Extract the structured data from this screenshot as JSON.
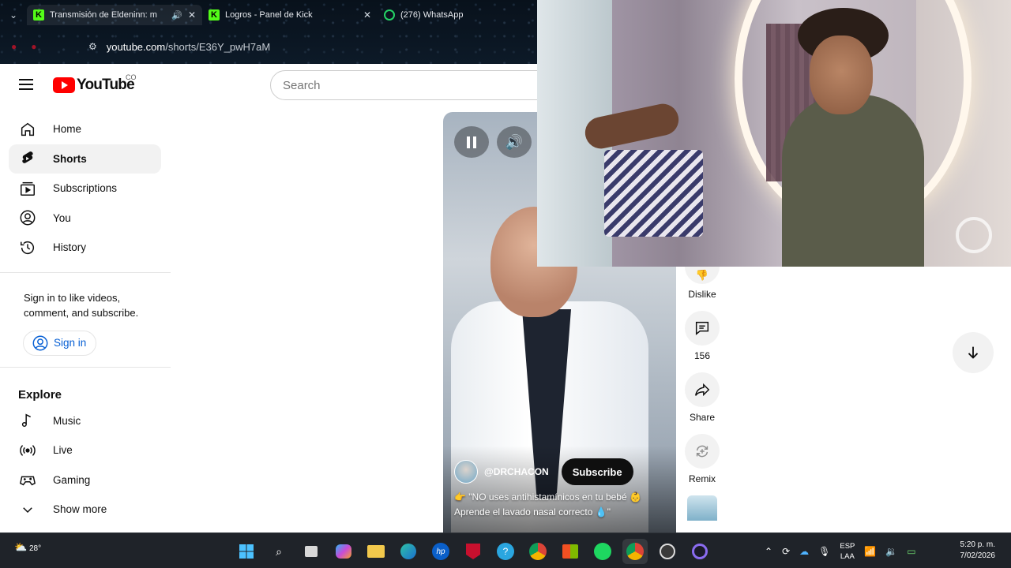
{
  "browser": {
    "tabs": [
      {
        "title": "Transmisión de Eldeninn: m",
        "icon": "kick-logo-icon"
      },
      {
        "title": "Logros - Panel de Kick",
        "icon": "kick-logo-icon"
      },
      {
        "title": "(276) WhatsApp",
        "icon": "whatsapp-icon"
      }
    ],
    "url_domain": "youtube.com",
    "url_path": "/shorts/E36Y_pwH7aM"
  },
  "youtube": {
    "logo_text": "YouTube",
    "country_code": "CO",
    "search_placeholder": "Search",
    "sidebar": {
      "main_items": [
        {
          "label": "Home",
          "icon": "home-icon"
        },
        {
          "label": "Shorts",
          "icon": "shorts-icon",
          "active": true
        },
        {
          "label": "Subscriptions",
          "icon": "subscriptions-icon"
        },
        {
          "label": "You",
          "icon": "account-icon"
        },
        {
          "label": "History",
          "icon": "history-icon"
        }
      ],
      "signin_prompt": "Sign in to like videos, comment, and subscribe.",
      "signin_button": "Sign in",
      "explore_title": "Explore",
      "explore_items": [
        {
          "label": "Music",
          "icon": "music-icon"
        },
        {
          "label": "Live",
          "icon": "live-icon"
        },
        {
          "label": "Gaming",
          "icon": "gaming-icon"
        },
        {
          "label": "Show more",
          "icon": "chevron-down-icon"
        }
      ]
    },
    "short": {
      "channel": "@DRCHACON",
      "subscribe_label": "Subscribe",
      "caption_line1": "👉 \"NO uses antihistamínicos en tu bebé 👶",
      "caption_line2": "Aprende el lavado nasal correcto 💧\""
    },
    "actions": [
      {
        "label": "Dislike",
        "icon": "dislike-icon"
      },
      {
        "label": "156",
        "icon": "comment-icon"
      },
      {
        "label": "Share",
        "icon": "share-icon"
      },
      {
        "label": "Remix",
        "icon": "remix-icon"
      }
    ]
  },
  "taskbar": {
    "temperature": "28°",
    "language_line1": "ESP",
    "language_line2": "LAA",
    "time": "5:20 p. m.",
    "date": "7/02/2026"
  },
  "colors": {
    "youtube_red": "#ff0000",
    "link_blue": "#065fd4",
    "kick_green": "#53fc18",
    "taskbar_bg": "#1f2329"
  }
}
